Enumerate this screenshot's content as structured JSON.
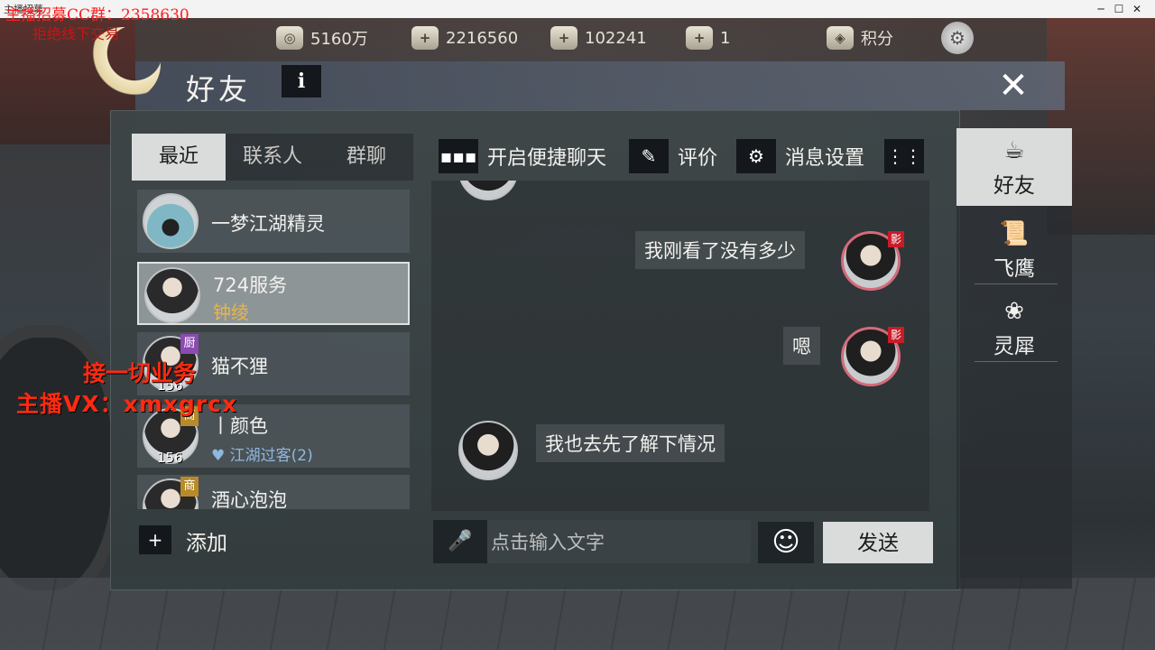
{
  "window": {
    "title": "主播招募",
    "min": "─",
    "max": "☐",
    "close": "✕"
  },
  "overlay": {
    "recruit": "主播招募CC群：2358630",
    "offline": "拒绝线下交易",
    "business": "接一切业务",
    "vx": "主播VX：xmxgrcx"
  },
  "resources": [
    {
      "icon": "film-reel-icon",
      "value": "5160万"
    },
    {
      "icon": "silver-ingot-icon",
      "value": "2216560"
    },
    {
      "icon": "jade-icon",
      "value": "102241"
    },
    {
      "icon": "gold-ingot-icon",
      "value": "1"
    }
  ],
  "points": {
    "label": "积分"
  },
  "panel": {
    "title": "好友",
    "info": "i",
    "close": "✕"
  },
  "tabs": [
    {
      "label": "最近"
    },
    {
      "label": "联系人"
    },
    {
      "label": "群聊"
    }
  ],
  "contacts": [
    {
      "name": "一梦江湖精灵",
      "sub": ""
    },
    {
      "name": "724服务",
      "sub": "钟绫"
    },
    {
      "name": "猫不狸",
      "sub": "",
      "badge": "厨",
      "level": "156"
    },
    {
      "name": "丨颜色",
      "sub": "江湖过客(2)",
      "badge": "商",
      "level": "156"
    },
    {
      "name": "酒心泡泡",
      "sub": "",
      "badge": "商"
    }
  ],
  "add": {
    "label": "添加"
  },
  "toolbar": {
    "quick_chat": "开启便捷聊天",
    "rate": "评价",
    "msg_settings": "消息设置"
  },
  "messages": [
    {
      "from": "me",
      "text": "我刚看了没有多少",
      "tag": "影"
    },
    {
      "from": "me",
      "text": "嗯",
      "tag": "影"
    },
    {
      "from": "them",
      "text": "我也去先了解下情况"
    }
  ],
  "composer": {
    "placeholder": "点击输入文字",
    "send": "发送"
  },
  "side_tabs": [
    {
      "label": "好友",
      "icon": "teapot-icon"
    },
    {
      "label": "飞鹰",
      "icon": "scroll-icon"
    },
    {
      "label": "灵犀",
      "icon": "charm-icon"
    }
  ]
}
